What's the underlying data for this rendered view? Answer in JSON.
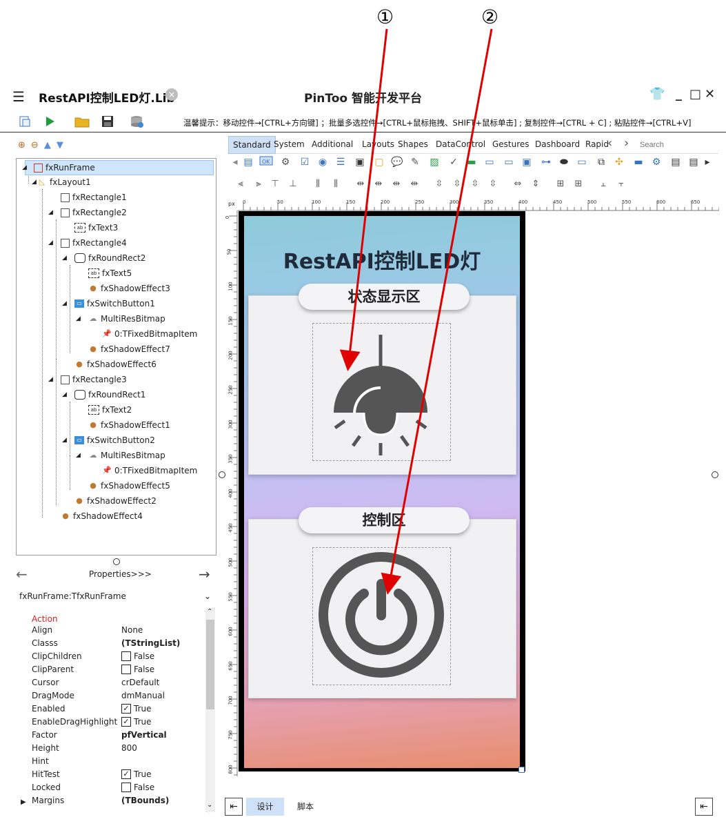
{
  "annotations": {
    "first": "①",
    "second": "②"
  },
  "titlebar": {
    "doc_name": "RestAPI控制LED灯.Lib",
    "close_doc": "×",
    "app_title": "PinToo 智能开发平台",
    "min": "_",
    "max": "□",
    "close": "✕"
  },
  "toolbar": {
    "tip": "温馨提示：移动控件→[CTRL+方向键] ；批量多选控件→[CTRL+鼠标拖拽、SHIFT+鼠标单击] ; 复制控件→[CTRL + C] ; 粘贴控件→[CTRL+V]"
  },
  "tree": {
    "nodes": [
      {
        "label": "fxRunFrame"
      },
      {
        "label": "fxLayout1"
      },
      {
        "label": "fxRectangle1"
      },
      {
        "label": "fxRectangle2"
      },
      {
        "label": "fxText3"
      },
      {
        "label": "fxRectangle4"
      },
      {
        "label": "fxRoundRect2"
      },
      {
        "label": "fxText5"
      },
      {
        "label": "fxShadowEffect3"
      },
      {
        "label": "fxSwitchButton1"
      },
      {
        "label": "MultiResBitmap"
      },
      {
        "label": "0:TFixedBitmapItem"
      },
      {
        "label": "fxShadowEffect7"
      },
      {
        "label": "fxShadowEffect6"
      },
      {
        "label": "fxRectangle3"
      },
      {
        "label": "fxRoundRect1"
      },
      {
        "label": "fxText2"
      },
      {
        "label": "fxShadowEffect1"
      },
      {
        "label": "fxSwitchButton2"
      },
      {
        "label": "MultiResBitmap"
      },
      {
        "label": "0:TFixedBitmapItem"
      },
      {
        "label": "fxShadowEffect5"
      },
      {
        "label": "fxShadowEffect2"
      },
      {
        "label": "fxShadowEffect4"
      }
    ]
  },
  "properties": {
    "nav_label": "Properties>>>",
    "object": "fxRunFrame:TfxRunFrame",
    "category": "Action",
    "rows": [
      {
        "name": "Align",
        "value": "None"
      },
      {
        "name": "Classs",
        "value": "(TStringList)"
      },
      {
        "name": "ClipChildren",
        "value": "False"
      },
      {
        "name": "ClipParent",
        "value": "False"
      },
      {
        "name": "Cursor",
        "value": "crDefault"
      },
      {
        "name": "DragMode",
        "value": "dmManual"
      },
      {
        "name": "Enabled",
        "value": "True"
      },
      {
        "name": "EnableDragHighlight",
        "value": "True"
      },
      {
        "name": "Factor",
        "value": "pfVertical"
      },
      {
        "name": "Height",
        "value": "800"
      },
      {
        "name": "Hint",
        "value": ""
      },
      {
        "name": "HitTest",
        "value": "True"
      },
      {
        "name": "Locked",
        "value": "False"
      },
      {
        "name": "Margins",
        "value": "(TBounds)"
      }
    ]
  },
  "palette": {
    "tabs": [
      "Standard",
      "System",
      "Additional",
      "Layouts",
      "Shapes",
      "DataControl",
      "Gestures",
      "Dashboard",
      "Rapid"
    ],
    "search_placeholder": "Search"
  },
  "ruler": {
    "unit": "px",
    "h": [
      "0",
      "50",
      "100",
      "150",
      "200",
      "250",
      "300",
      "350",
      "400",
      "450",
      "500",
      "550",
      "600",
      "650"
    ],
    "v": [
      "0",
      "50",
      "100",
      "150",
      "200",
      "250",
      "300",
      "350",
      "400",
      "450",
      "500",
      "550",
      "600",
      "650",
      "700",
      "750",
      "800"
    ]
  },
  "canvas": {
    "headline": "RestAPI控制LED灯",
    "status_tag": "状态显示区",
    "control_tag": "控制区"
  },
  "bottom": {
    "design_tab": "设计",
    "script_tab": "脚本"
  },
  "colors": {
    "accent": "#cfe1f7",
    "arrow": "#e00000"
  }
}
